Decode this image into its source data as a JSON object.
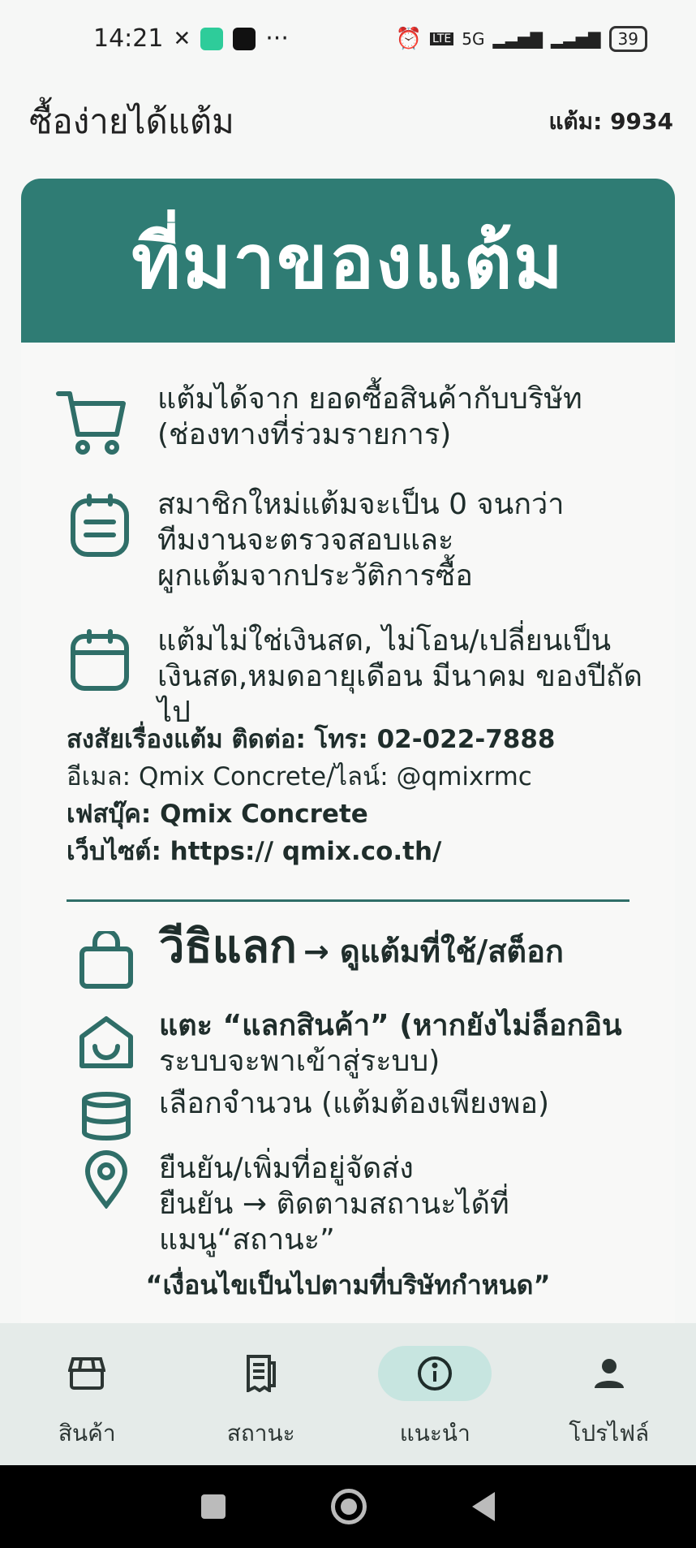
{
  "status_bar": {
    "time": "14:21",
    "network": "5G",
    "lte": "LTE",
    "battery": "39"
  },
  "app_bar": {
    "title": "ซื้อง่ายได้แต้ม",
    "points": "แต้ม: 9934"
  },
  "banner": {
    "title": "ที่มาของแต้ม"
  },
  "sources": [
    {
      "icon": "cart-icon",
      "line1": "แต้มได้จาก ยอดซื้อสินค้ากับบริษัท",
      "line2": "(ช่องทางที่ร่วมรายการ)"
    },
    {
      "icon": "note-icon",
      "line1": "สมาชิกใหม่แต้มจะเป็น 0 จนกว่า",
      "line2": "ทีมงานจะตรวจสอบและ",
      "line3": "ผูกแต้มจากประวัติการซื้อ"
    },
    {
      "icon": "calendar-icon",
      "line1": "แต้มไม่ใช่เงินสด, ไม่โอน/เปลี่ยนเป็น",
      "line2": "เงินสด,หมดอายุเดือน มีนาคม ของปีถัดไป"
    }
  ],
  "contact": {
    "line1": "สงสัยเรื่องแต้ม ติดต่อ: โทร: 02-022-7888",
    "line2": "อีเมล: Qmix Concrete/ไลน์: @qmixrmc",
    "line3": "เฟสบุ๊ค: Qmix Concrete",
    "line4": "เว็บไซต์: https:// qmix.co.th/"
  },
  "howto": {
    "title": "วีธิแลก",
    "arrow_text": "→ ดูแต้มที่ใช้/สต็อก",
    "steps": [
      {
        "icon": "bag-icon",
        "line1": "แตะ “แลกสินค้า” (หากยังไม่ล็อกอิน",
        "line2": "ระบบจะพาเข้าสู่ระบบ)"
      },
      {
        "icon": "database-icon",
        "line1": "เลือกจำนวน (แต้มต้องเพียงพอ)"
      },
      {
        "icon": "location-icon",
        "line1": "ยืนยัน/เพิ่มที่อยู่จัดส่ง",
        "line2": "ยืนยัน → ติดตามสถานะได้ที่แมนู“สถานะ”"
      }
    ]
  },
  "disclaimer": "“เงื่อนไขเป็นไปตามที่บริษัทกำหนด”",
  "bottom_nav": [
    {
      "label": "สินค้า",
      "icon": "store-icon",
      "active": false
    },
    {
      "label": "สถานะ",
      "icon": "receipt-icon",
      "active": false
    },
    {
      "label": "แนะนำ",
      "icon": "info-icon",
      "active": true
    },
    {
      "label": "โปรไฟล์",
      "icon": "person-icon",
      "active": false
    }
  ],
  "colors": {
    "accent": "#2f7c74",
    "nav_bg": "#e5ebe9",
    "active_pill": "#c7e5e0"
  }
}
